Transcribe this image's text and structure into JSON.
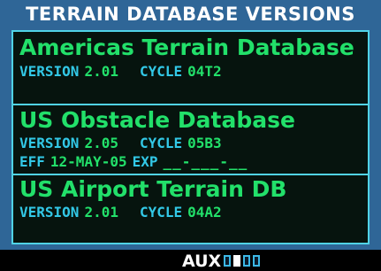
{
  "page": {
    "title": "TERRAIN DATABASE VERSIONS"
  },
  "databases": [
    {
      "name": "Americas Terrain Database",
      "version_label": "VERSION",
      "version": "2.01",
      "cycle_label": "CYCLE",
      "cycle": "04T2"
    },
    {
      "name": "US Obstacle Database",
      "version_label": "VERSION",
      "version": "2.05",
      "cycle_label": "CYCLE",
      "cycle": "05B3",
      "eff_label": "EFF",
      "eff": "12-MAY-05",
      "exp_label": "EXP",
      "exp": "__-___-__"
    },
    {
      "name": "US Airport Terrain DB",
      "version_label": "VERSION",
      "version": "2.01",
      "cycle_label": "CYCLE",
      "cycle": "04A2"
    }
  ],
  "footer": {
    "page_group": "AUX",
    "page_count": 4,
    "active_page_index": 1
  },
  "colors": {
    "background": "#2f6697",
    "panel": "#06140e",
    "border_cyan": "#50d3e6",
    "green_text": "#22e06a",
    "cyan_text": "#32c8e6",
    "title_text": "#ffffff"
  }
}
